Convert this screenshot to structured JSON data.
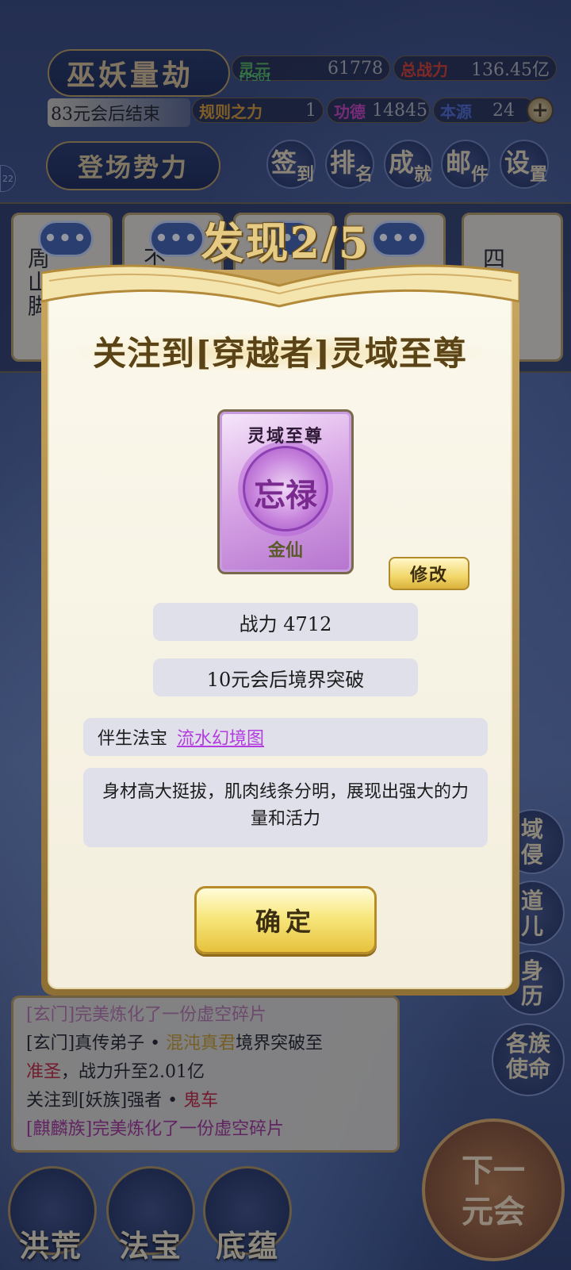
{
  "hud": {
    "mode_title": "巫妖量劫",
    "countdown": "83元会后结束",
    "fps": "FPS61",
    "side_badge": "22",
    "stats": {
      "lingyuan_label": "灵元",
      "lingyuan_value": "61778",
      "total_power_label": "总战力",
      "total_power_value": "136.45亿",
      "rule_label": "规则之力",
      "rule_value": "1",
      "merit_label": "功德",
      "merit_value": "14845",
      "source_label": "本源",
      "source_value": "24"
    },
    "faction_button": "登场势力",
    "top_buttons": [
      {
        "big": "签",
        "small": "到"
      },
      {
        "big": "排",
        "small": "名"
      },
      {
        "big": "成",
        "small": "就"
      },
      {
        "big": "邮",
        "small": "件"
      },
      {
        "big": "设",
        "small": "置"
      }
    ]
  },
  "entity_cards": [
    {
      "text": "周山脚"
    },
    {
      "text": "不"
    },
    {
      "text": ""
    },
    {
      "text": ""
    },
    {
      "text": "四海龙族"
    }
  ],
  "bubbles": [
    "•••",
    "•••",
    "•••",
    "•••"
  ],
  "right_buttons": [
    {
      "line1": "域",
      "line2": "侵"
    },
    {
      "line1": "道",
      "line2": "儿"
    },
    {
      "line1": "身",
      "line2": "历"
    },
    {
      "line1": "各族",
      "line2": "使命"
    }
  ],
  "modal": {
    "header": "发现2/5",
    "title": "关注到[穿越者]灵域至尊",
    "portrait": {
      "name": "灵域至尊",
      "mark": "忘禄",
      "realm": "金仙"
    },
    "edit_button": "修改",
    "power": "战力 4712",
    "breakthrough": "10元会后境界突破",
    "treasure_label": "伴生法宝",
    "treasure_name": "流水幻境图",
    "description": "身材高大挺拔，肌肉线条分明，展现出强大的力量和活力",
    "confirm_button": "确定"
  },
  "log": {
    "line0": "[玄门]完美炼化了一份虚空碎片",
    "line1_a": "[玄门]真传弟子 • ",
    "line1_b": "混沌真君",
    "line1_c": "境界突破至",
    "line2_a": "准圣",
    "line2_b": "，战力升至2.01亿",
    "line3_a": "关注到[妖族]强者 • ",
    "line3_b": "鬼车",
    "line4": "[麒麟族]完美炼化了一份虚空碎片"
  },
  "bottom_nav": [
    {
      "label": "洪荒"
    },
    {
      "label": "法宝"
    },
    {
      "label": "底蕴"
    }
  ],
  "next_button": {
    "line1": "下一",
    "line2": "元会"
  },
  "colors": {
    "gold": "#c9a760",
    "cream": "#fbf8ec",
    "pill": "#dfe0ea",
    "link_purple": "#b43be0",
    "log_red": "#c22030"
  }
}
